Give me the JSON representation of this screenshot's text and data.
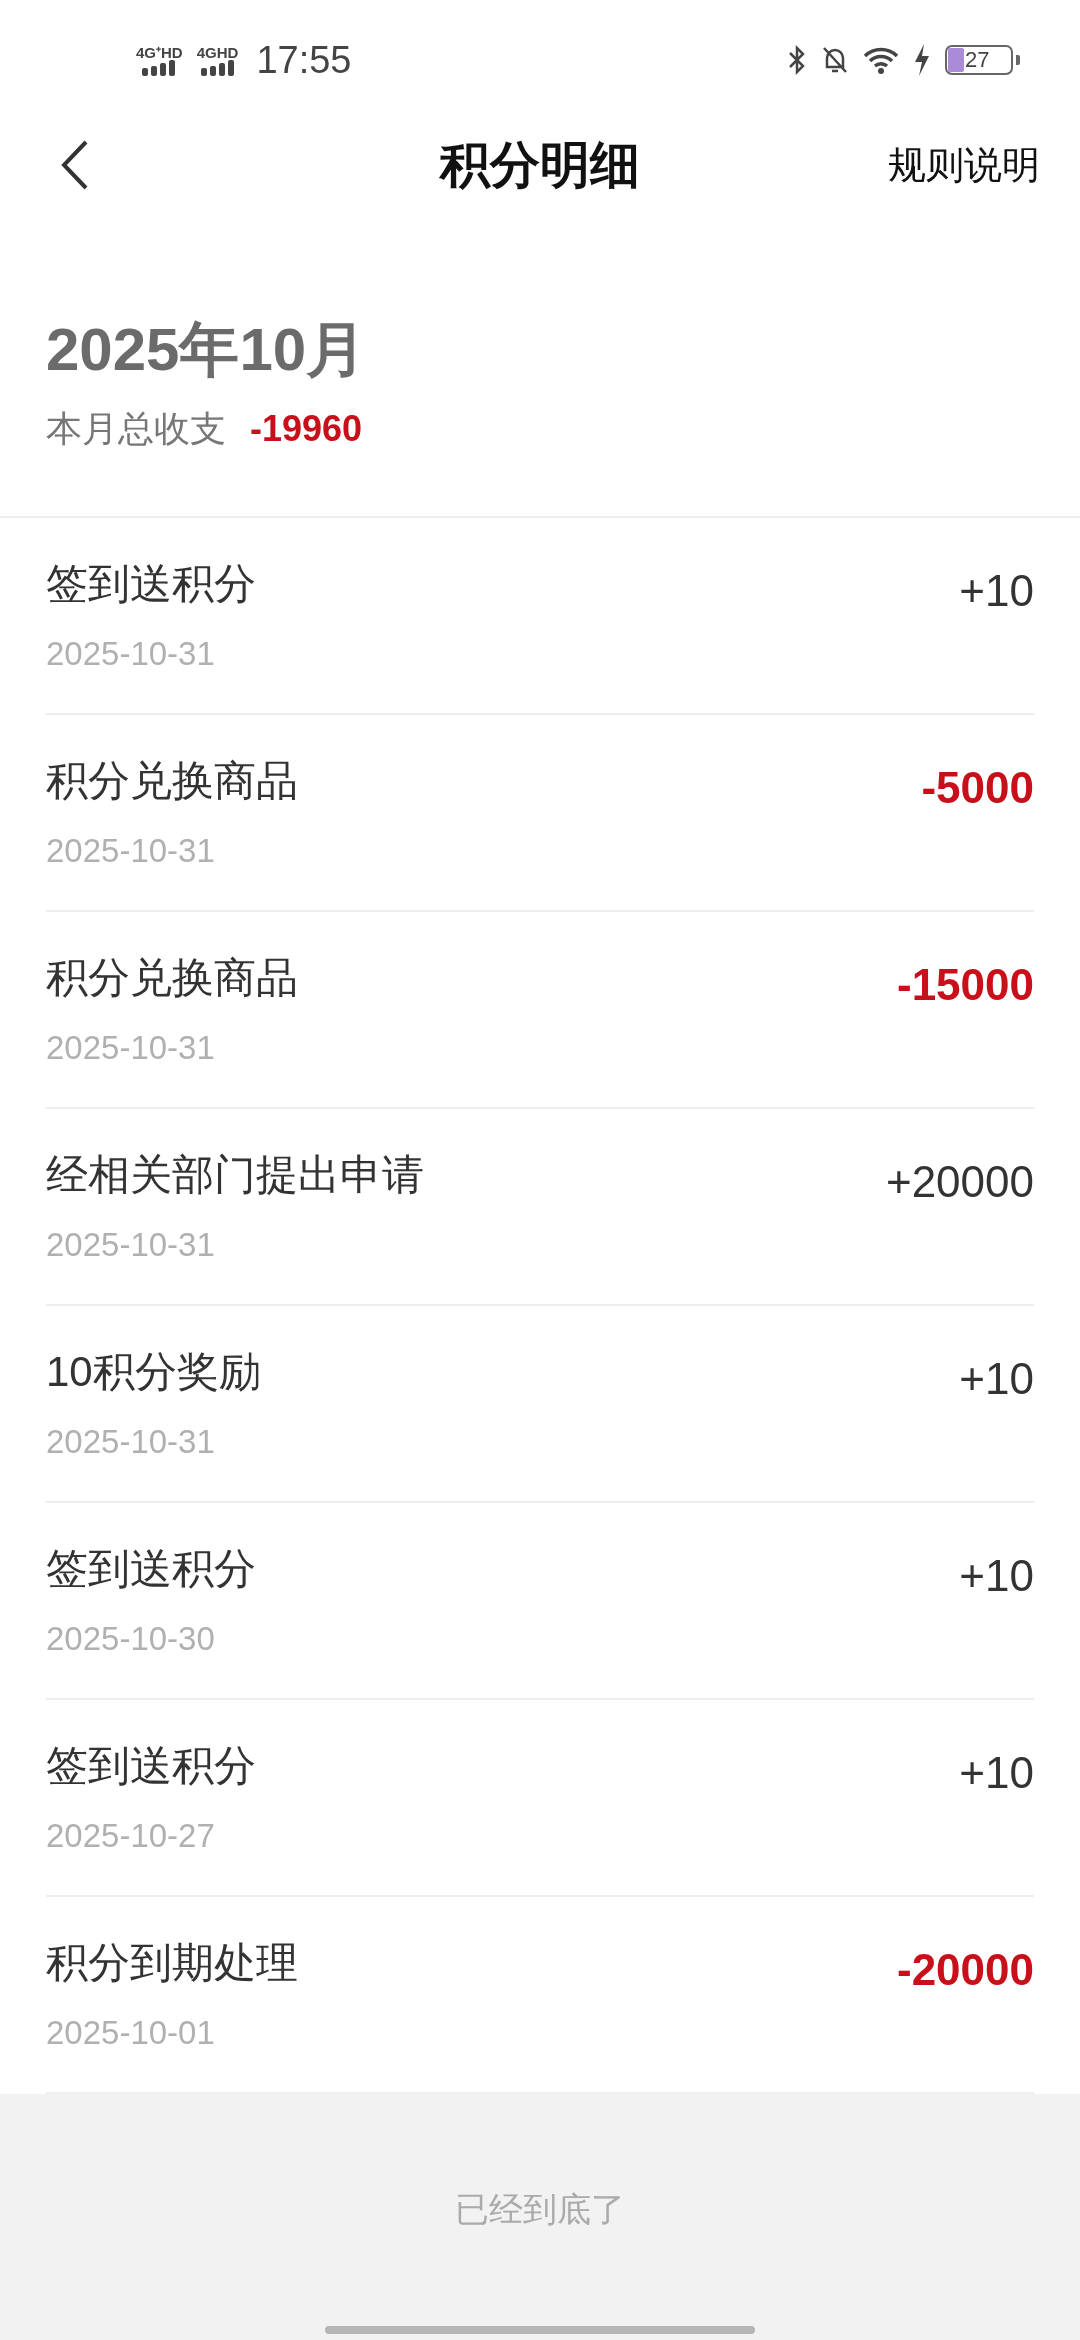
{
  "status_bar": {
    "networks": [
      "4G⁺HD",
      "4GHD"
    ],
    "time": "17:55",
    "battery": {
      "text": "27",
      "level": 0.27
    }
  },
  "header": {
    "title": "积分明细",
    "action": "规则说明"
  },
  "month": {
    "title": "2025年10月",
    "summary_label": "本月总收支",
    "summary_value": "-19960"
  },
  "records": [
    {
      "title": "签到送积分",
      "date": "2025-10-31",
      "amount": "+10",
      "kind": "income"
    },
    {
      "title": "积分兑换商品",
      "date": "2025-10-31",
      "amount": "-5000",
      "kind": "expense"
    },
    {
      "title": "积分兑换商品",
      "date": "2025-10-31",
      "amount": "-15000",
      "kind": "expense"
    },
    {
      "title": "经相关部门提出申请",
      "date": "2025-10-31",
      "amount": "+20000",
      "kind": "income"
    },
    {
      "title": "10积分奖励",
      "date": "2025-10-31",
      "amount": "+10",
      "kind": "income"
    },
    {
      "title": "签到送积分",
      "date": "2025-10-30",
      "amount": "+10",
      "kind": "income"
    },
    {
      "title": "签到送积分",
      "date": "2025-10-27",
      "amount": "+10",
      "kind": "income"
    },
    {
      "title": "积分到期处理",
      "date": "2025-10-01",
      "amount": "-20000",
      "kind": "expense"
    }
  ],
  "footer": "已经到底了"
}
